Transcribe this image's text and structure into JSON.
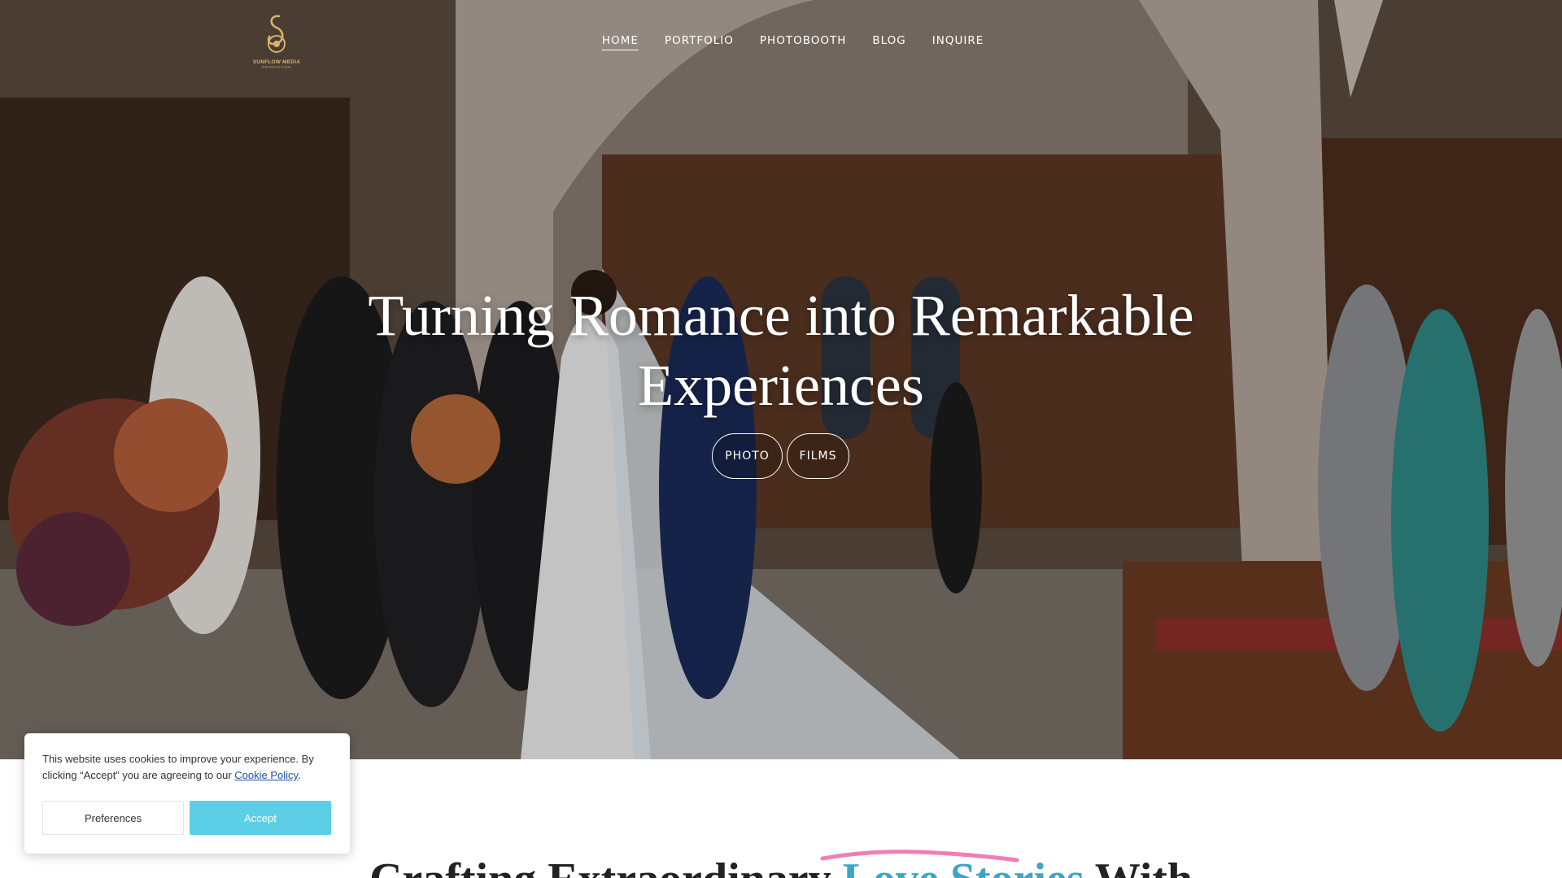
{
  "brand": {
    "logo_text": "SUNFLOW MEDIA",
    "logo_subtext": "PRODUCTION",
    "logo_color": "#d9b36a"
  },
  "nav": {
    "items": [
      {
        "label": "HOME",
        "active": true
      },
      {
        "label": "PORTFOLIO",
        "active": false
      },
      {
        "label": "PHOTOBOOTH",
        "active": false
      },
      {
        "label": "BLOG",
        "active": false
      },
      {
        "label": "INQUIRE",
        "active": false
      }
    ]
  },
  "hero": {
    "title_line1": "Turning Romance into Remarkable",
    "title_line2": "Experiences",
    "buttons": [
      "PHOTO",
      "FILMS"
    ]
  },
  "section": {
    "heading_before": "Crafting Extraordinary ",
    "heading_accent": "Love Stories",
    "heading_after": " With",
    "accent_color": "#3aa7c4",
    "underline_color": "#ef7fb3"
  },
  "cookie": {
    "text": "This website uses cookies to improve your experience. By clicking “Accept” you are agreeing to our ",
    "link_text": "Cookie Policy",
    "text_end": ".",
    "preferences_label": "Preferences",
    "accept_label": "Accept",
    "accept_color": "#5ccfe6"
  }
}
